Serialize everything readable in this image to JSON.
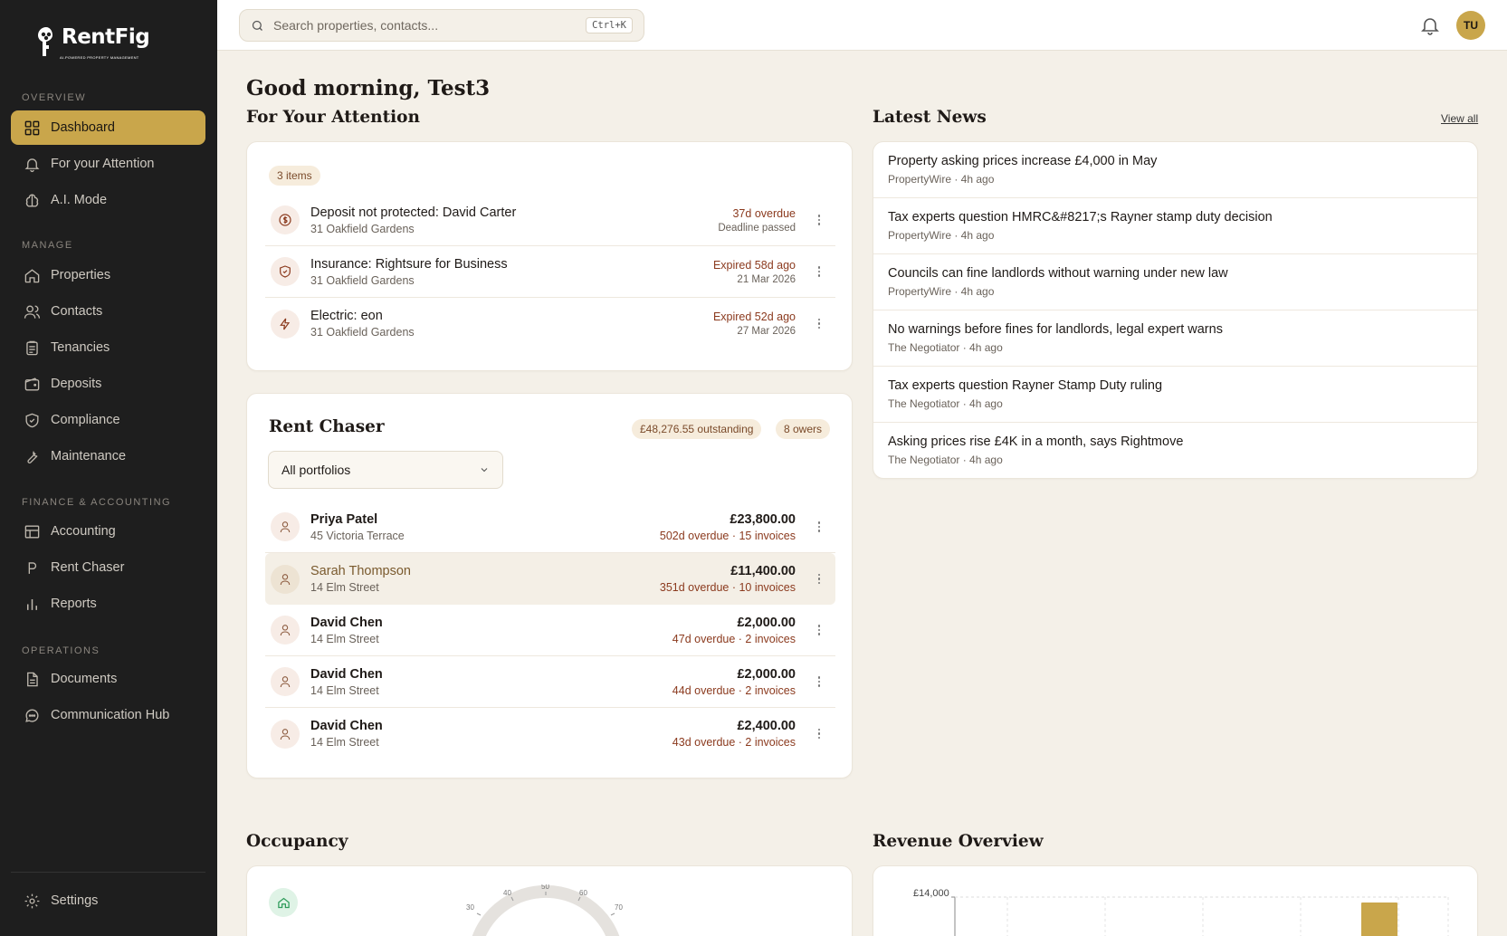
{
  "brand": {
    "name": "RentFig",
    "tagline": "AI-POWERED PROPERTY MANAGEMENT"
  },
  "sidebar": {
    "sections": [
      {
        "label": "OVERVIEW"
      },
      {
        "label": "MANAGE"
      },
      {
        "label": "FINANCE & ACCOUNTING"
      },
      {
        "label": "OPERATIONS"
      }
    ],
    "items": [
      {
        "label": "Dashboard",
        "icon": "grid-icon",
        "active": true
      },
      {
        "label": "For your Attention",
        "icon": "bell-icon"
      },
      {
        "label": "A.I. Mode",
        "icon": "brain-icon"
      },
      {
        "label": "Properties",
        "icon": "home-icon"
      },
      {
        "label": "Contacts",
        "icon": "users-icon"
      },
      {
        "label": "Tenancies",
        "icon": "clipboard-icon"
      },
      {
        "label": "Deposits",
        "icon": "wallet-icon"
      },
      {
        "label": "Compliance",
        "icon": "shield-check-icon"
      },
      {
        "label": "Maintenance",
        "icon": "wrench-icon"
      },
      {
        "label": "Accounting",
        "icon": "table-icon"
      },
      {
        "label": "Rent Chaser",
        "icon": "pound-icon"
      },
      {
        "label": "Reports",
        "icon": "bar-chart-icon"
      },
      {
        "label": "Documents",
        "icon": "file-icon"
      },
      {
        "label": "Communication Hub",
        "icon": "chat-icon"
      }
    ],
    "settings": "Settings"
  },
  "topbar": {
    "search_placeholder": "Search properties, contacts...",
    "shortcut": "Ctrl+K",
    "avatar_initials": "TU"
  },
  "greeting": "Good morning, Test3",
  "attention": {
    "title": "For Your Attention",
    "count": "3 items",
    "items": [
      {
        "title": "Deposit not protected: David Carter",
        "address": "31 Oakfield Gardens",
        "status": "37d overdue",
        "sub": "Deadline passed",
        "icon": "dollar-icon"
      },
      {
        "title": "Insurance: Rightsure for Business",
        "address": "31 Oakfield Gardens",
        "status": "Expired 58d ago",
        "sub": "21 Mar 2026",
        "icon": "shield-icon"
      },
      {
        "title": "Electric: eon",
        "address": "31 Oakfield Gardens",
        "status": "Expired 52d ago",
        "sub": "27 Mar 2026",
        "icon": "lightning-icon"
      }
    ]
  },
  "rent_chaser": {
    "title": "Rent Chaser",
    "outstanding": "£48,276.55 outstanding",
    "owers": "8 owers",
    "filter": "All portfolios",
    "rows": [
      {
        "name": "Priya Patel",
        "address": "45 Victoria Terrace",
        "amount": "£23,800.00",
        "detail": "502d overdue · 15 invoices"
      },
      {
        "name": "Sarah Thompson",
        "address": "14 Elm Street",
        "amount": "£11,400.00",
        "detail": "351d overdue · 10 invoices"
      },
      {
        "name": "David Chen",
        "address": "14 Elm Street",
        "amount": "£2,000.00",
        "detail": "47d overdue · 2 invoices"
      },
      {
        "name": "David Chen",
        "address": "14 Elm Street",
        "amount": "£2,000.00",
        "detail": "44d overdue · 2 invoices"
      },
      {
        "name": "David Chen",
        "address": "14 Elm Street",
        "amount": "£2,400.00",
        "detail": "43d overdue · 2 invoices"
      }
    ]
  },
  "news": {
    "title": "Latest News",
    "view_all": "View all",
    "items": [
      {
        "title": "Property asking prices increase £4,000 in May",
        "source": "PropertyWire · 4h ago"
      },
      {
        "title": "Tax experts question HMRC&#8217;s Rayner stamp duty decision",
        "source": "PropertyWire · 4h ago"
      },
      {
        "title": "Councils can fine landlords without warning under new law",
        "source": "PropertyWire · 4h ago"
      },
      {
        "title": "No warnings before fines for landlords, legal expert warns",
        "source": "The Negotiator · 4h ago"
      },
      {
        "title": "Tax experts question Rayner Stamp Duty ruling",
        "source": "The Negotiator · 4h ago"
      },
      {
        "title": "Asking prices rise £4K in a month, says Rightmove",
        "source": "The Negotiator · 4h ago"
      }
    ]
  },
  "occupancy": {
    "title": "Occupancy",
    "gauge_ticks": [
      "30",
      "40",
      "50",
      "60",
      "70"
    ]
  },
  "revenue": {
    "title": "Revenue Overview",
    "y_tick": "£14,000"
  },
  "colors": {
    "accent": "#c9a64b",
    "sidebar_bg": "#1e1e1e",
    "page_bg": "#f4f0e8",
    "overdue": "#8b3a1e"
  }
}
